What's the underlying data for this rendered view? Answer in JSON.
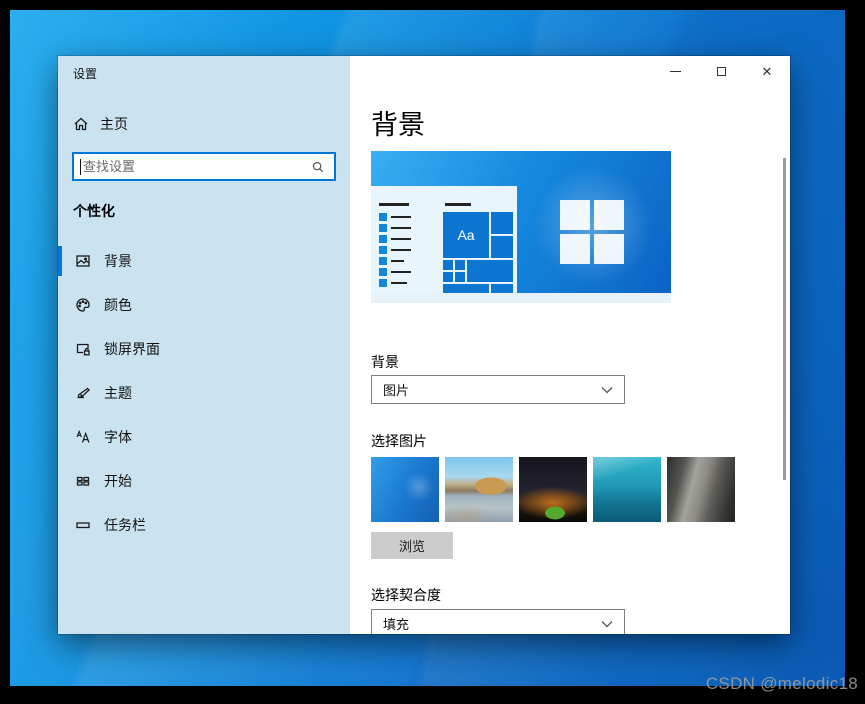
{
  "watermark": "CSDN @melodic18",
  "colors": {
    "accent": "#0078d7",
    "sidebar_bg": "#cbe3f1",
    "desktop_blue": "#0f93e2"
  },
  "window": {
    "title": "设置",
    "sidebar": {
      "home_label": "主页",
      "search_placeholder": "查找设置",
      "section_title": "个性化",
      "items": [
        {
          "label": "背景",
          "icon": "image-icon",
          "selected": true
        },
        {
          "label": "颜色",
          "icon": "palette-icon",
          "selected": false
        },
        {
          "label": "锁屏界面",
          "icon": "lockscreen-icon",
          "selected": false
        },
        {
          "label": "主题",
          "icon": "theme-icon",
          "selected": false
        },
        {
          "label": "字体",
          "icon": "fonts-icon",
          "selected": false
        },
        {
          "label": "开始",
          "icon": "start-icon",
          "selected": false
        },
        {
          "label": "任务栏",
          "icon": "taskbar-icon",
          "selected": false
        }
      ]
    },
    "content": {
      "page_title": "背景",
      "preview_tile_label": "Aa",
      "background_label": "背景",
      "background_value": "图片",
      "choose_picture_label": "选择图片",
      "thumbnails": [
        "windows-default",
        "beach-rocks",
        "night-camping",
        "underwater",
        "rock-face"
      ],
      "browse_label": "浏览",
      "choose_fit_label": "选择契合度",
      "fit_value": "填充"
    }
  }
}
